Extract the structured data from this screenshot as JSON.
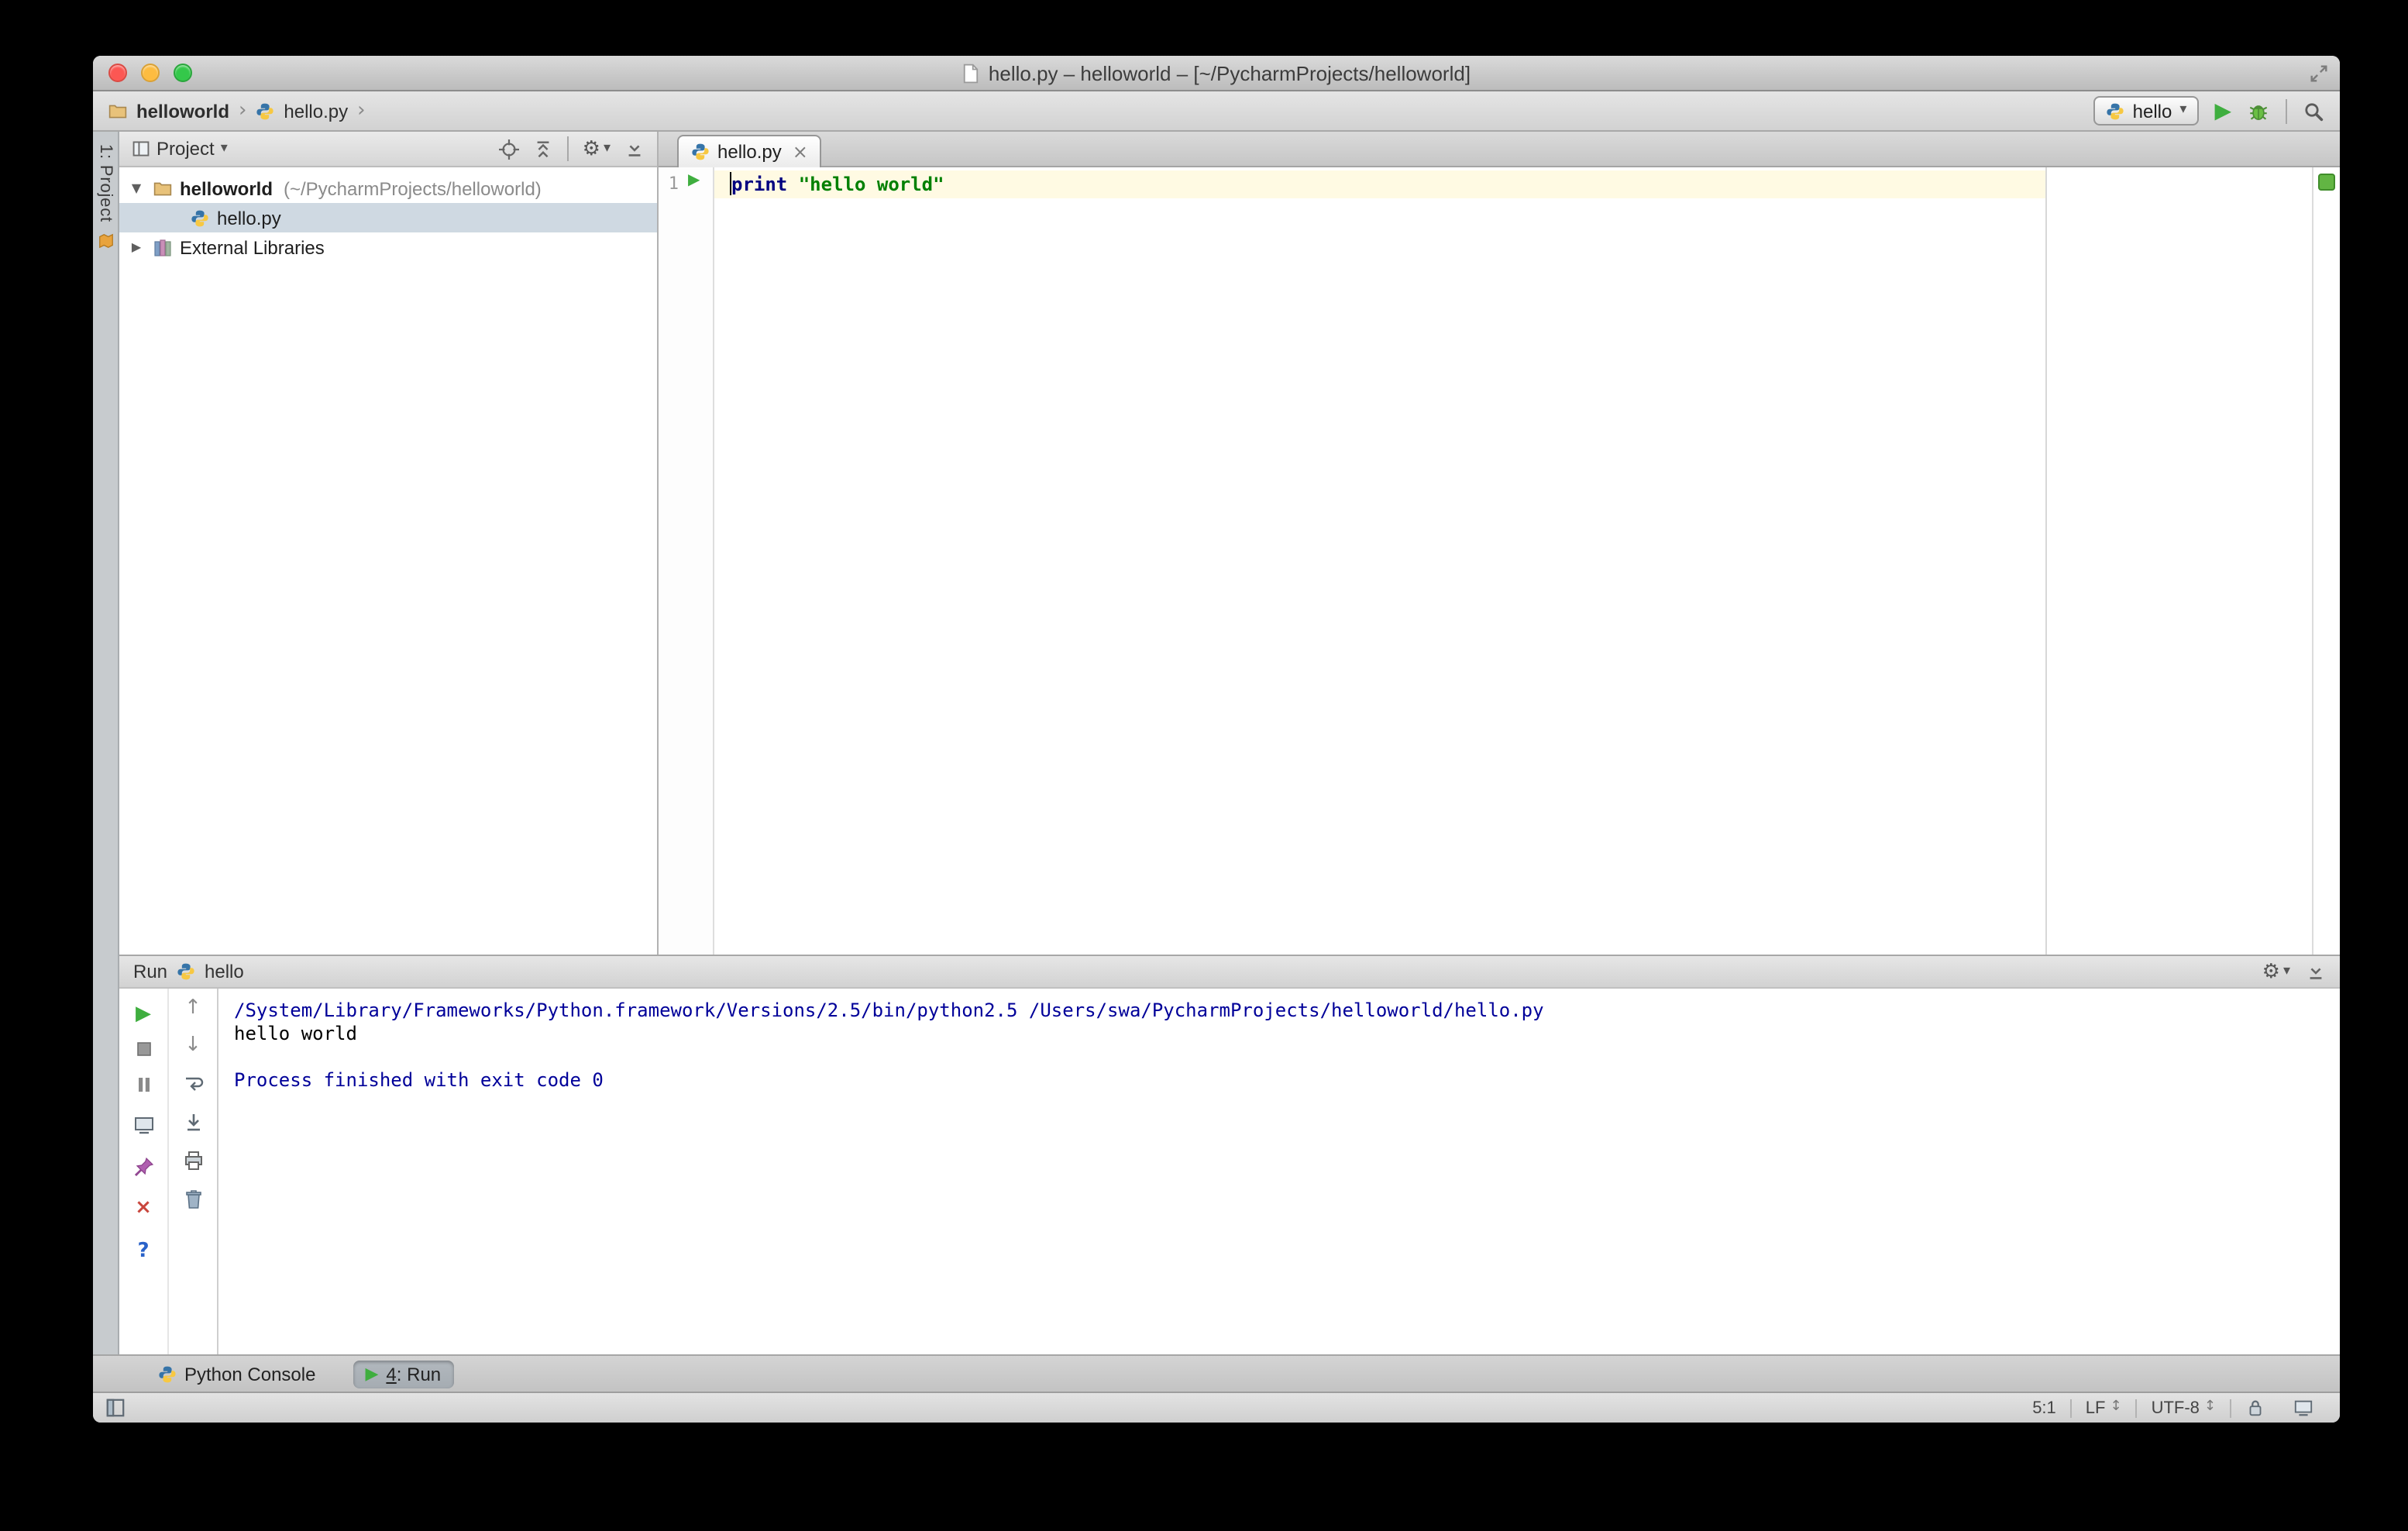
{
  "window": {
    "title": "hello.py – helloworld – [~/PycharmProjects/helloworld]"
  },
  "navbar": {
    "crumb1": "helloworld",
    "crumb2": "hello.py",
    "run_config": "hello"
  },
  "tool_strip": {
    "project_button": "1: Project"
  },
  "project_panel": {
    "header_title": "Project",
    "tree": [
      {
        "name": "helloworld",
        "path": "(~/PycharmProjects/helloworld)"
      },
      {
        "name": "hello.py"
      },
      {
        "name": "External Libraries"
      }
    ]
  },
  "editor": {
    "tab_label": "hello.py",
    "line_number": "1",
    "tokens": [
      {
        "text": "print",
        "type": "keyword"
      },
      {
        "text": " ",
        "type": "plain"
      },
      {
        "text": "\"hello world\"",
        "type": "string"
      }
    ]
  },
  "run_panel": {
    "title": "Run",
    "config": "hello",
    "console": [
      "/System/Library/Frameworks/Python.framework/Versions/2.5/bin/python2.5 /Users/swa/PycharmProjects/helloworld/hello.py",
      "hello world",
      "",
      "Process finished with exit code 0"
    ]
  },
  "bottom_bar": {
    "python_console": "Python Console",
    "run_tab_mnemonic": "4",
    "run_tab_rest": ": Run"
  },
  "status_bar": {
    "caret_position": "5:1",
    "line_separator": "LF",
    "encoding": "UTF-8"
  },
  "icons": {
    "chevron": "›",
    "dropdown": "▾",
    "run": "▶",
    "close": "×",
    "help": "?",
    "up": "↑",
    "down": "↓",
    "gear": "⚙",
    "tree_expanded": "▼",
    "tree_collapsed": "▶",
    "spinner": "↕"
  },
  "colors": {
    "run_green": "#3fae3f",
    "keyword": "#000080",
    "string": "#008000",
    "console_system": "#000099",
    "caret_line_highlight": "#fffae3",
    "tree_selection": "#cfd9e2",
    "inspection_ok": "#62b543"
  }
}
